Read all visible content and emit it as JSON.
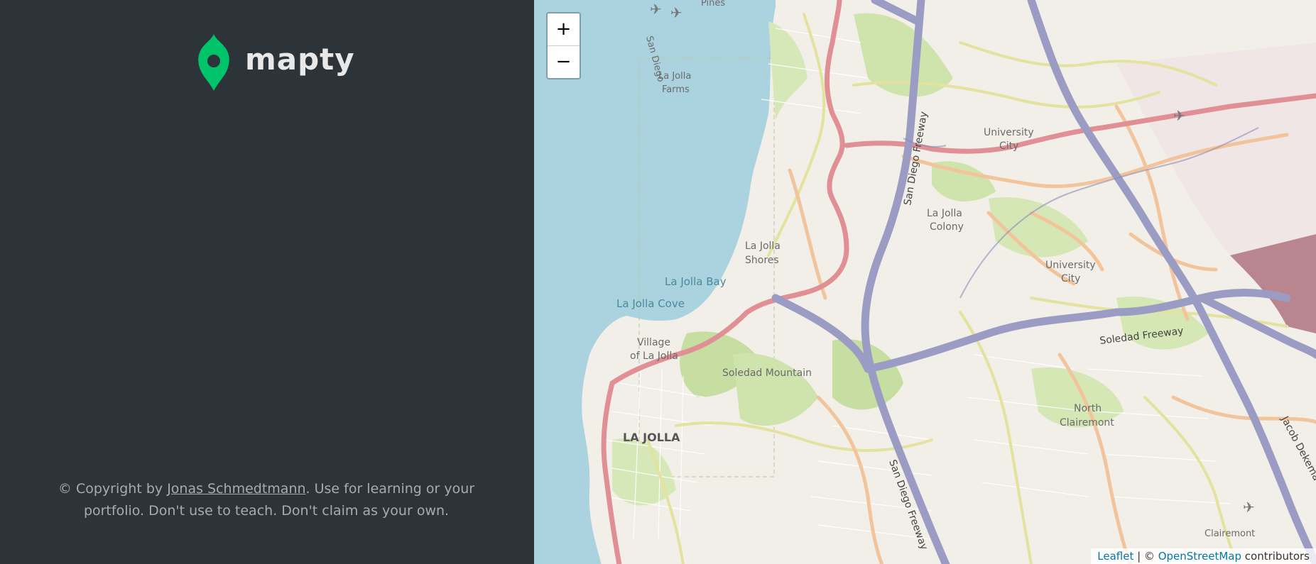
{
  "sidebar": {
    "logo_text": "mapty",
    "copyright": {
      "prefix": "© Copyright by ",
      "author_link": "Jonas Schmedtmann",
      "line1_suffix": ". Use for learning or your",
      "line2": "portfolio. Don't use to teach. Don't claim as your own."
    }
  },
  "map": {
    "zoom_in_label": "+",
    "zoom_out_label": "−",
    "attribution": {
      "leaflet_link": "Leaflet",
      "separator": " | © ",
      "osm_link": "OpenStreetMap",
      "suffix": " contributors"
    },
    "labels": {
      "pines": "Pines",
      "san_diego_coast": "San Diego",
      "la_jolla_farms_1": "La Jolla",
      "la_jolla_farms_2": "Farms",
      "san_diego_freeway_north": "San Diego Freeway",
      "university_city_1_a": "University",
      "university_city_1_b": "City",
      "la_jolla_colony_a": "La Jolla",
      "la_jolla_colony_b": "Colony",
      "la_jolla_shores_a": "La Jolla",
      "la_jolla_shores_b": "Shores",
      "la_jolla_bay": "La Jolla Bay",
      "la_jolla_cove": "La Jolla Cove",
      "university_city_2_a": "University",
      "university_city_2_b": "City",
      "village_a": "Village",
      "village_b": "of La Jolla",
      "soledad_mountain": "Soledad Mountain",
      "soledad_freeway": "Soledad Freeway",
      "la_jolla": "LA JOLLA",
      "north_clairemont_a": "North",
      "north_clairemont_b": "Clairemont",
      "jacob_dekema": "Jacob Dekema",
      "san_diego_freeway_south": "San Diego Freeway",
      "clairemont": "Clairemont"
    },
    "colors": {
      "ocean": "#aad3df",
      "land": "#f2efe9",
      "park": "#c8facc",
      "wood": "#add19e",
      "motorway": "#9b9cc4",
      "trunk": "#e4949c",
      "secondary": "#f2c49b",
      "tertiary": "#f7fabf"
    }
  }
}
